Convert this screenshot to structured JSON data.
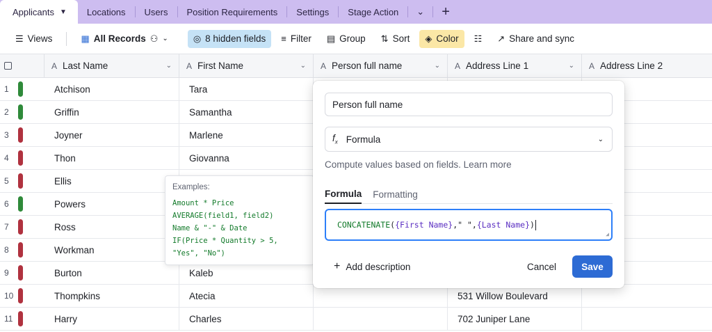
{
  "tabs": [
    {
      "label": "Applicants",
      "active": true
    },
    {
      "label": "Locations"
    },
    {
      "label": "Users"
    },
    {
      "label": "Position Requirements"
    },
    {
      "label": "Settings"
    },
    {
      "label": "Stage Action"
    }
  ],
  "toolbar": {
    "views": "Views",
    "all_records": "All Records",
    "hidden_fields": "8 hidden fields",
    "filter": "Filter",
    "group": "Group",
    "sort": "Sort",
    "color": "Color",
    "share": "Share and sync"
  },
  "columns": [
    "Last Name",
    "First Name",
    "Person full name",
    "Address Line 1",
    "Address Line 2"
  ],
  "rows": [
    {
      "n": "1",
      "status": "green",
      "last": "Atchison",
      "first": "Tara",
      "addr1": ""
    },
    {
      "n": "2",
      "status": "green",
      "last": "Griffin",
      "first": "Samantha",
      "addr1": ""
    },
    {
      "n": "3",
      "status": "red",
      "last": "Joyner",
      "first": "Marlene",
      "addr1": ""
    },
    {
      "n": "4",
      "status": "red",
      "last": "Thon",
      "first": "Giovanna",
      "addr1": ""
    },
    {
      "n": "5",
      "status": "red",
      "last": "Ellis",
      "first": "",
      "addr1": ""
    },
    {
      "n": "6",
      "status": "green",
      "last": "Powers",
      "first": "",
      "addr1": ""
    },
    {
      "n": "7",
      "status": "red",
      "last": "Ross",
      "first": "",
      "addr1": ""
    },
    {
      "n": "8",
      "status": "red",
      "last": "Workman",
      "first": "",
      "addr1": ""
    },
    {
      "n": "9",
      "status": "red",
      "last": "Burton",
      "first": "Kaleb",
      "addr1": ""
    },
    {
      "n": "10",
      "status": "red",
      "last": "Thompkins",
      "first": "Atecia",
      "addr1": "531 Willow Boulevard"
    },
    {
      "n": "11",
      "status": "red",
      "last": "Harry",
      "first": "Charles",
      "addr1": "702 Juniper Lane"
    }
  ],
  "colors": {
    "green": "#2f8a3a",
    "red": "#b0323f",
    "accent": "#2d6bd4"
  },
  "popover": {
    "field_name": "Person full name",
    "field_type": "Formula",
    "hint": "Compute values based on fields.",
    "learn_more": "Learn more",
    "tab_formula": "Formula",
    "tab_formatting": "Formatting",
    "formula": {
      "fn": "CONCATENATE",
      "open": "(",
      "arg1": "{First Name}",
      "sep": ",\" \",",
      "arg2": "{Last Name}",
      "close": ")"
    },
    "add_description": "Add description",
    "cancel": "Cancel",
    "save": "Save"
  },
  "examples": {
    "title": "Examples:",
    "lines": [
      "Amount * Price",
      "AVERAGE(field1, field2)",
      "Name & \"-\" & Date",
      "IF(Price * Quantity > 5,",
      "\"Yes\", \"No\")"
    ]
  }
}
